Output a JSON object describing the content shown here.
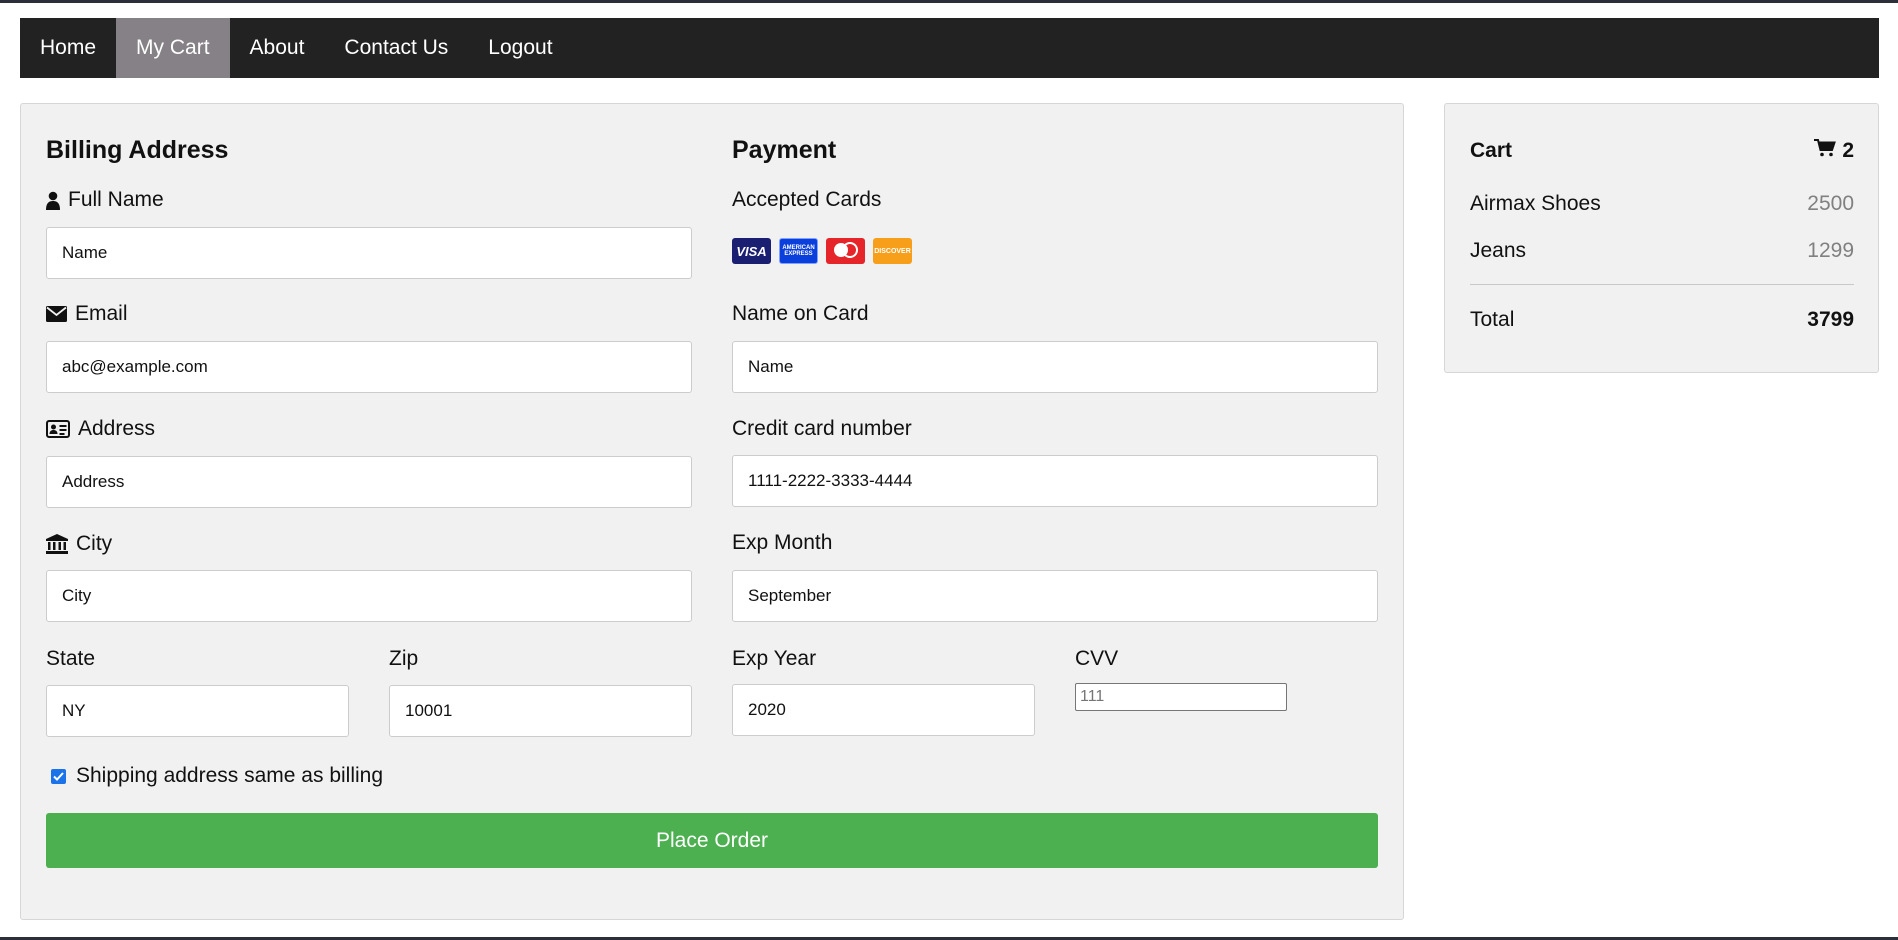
{
  "nav": {
    "items": [
      "Home",
      "My Cart",
      "About",
      "Contact Us",
      "Logout"
    ],
    "active": "My Cart"
  },
  "billing": {
    "title": "Billing Address",
    "full_name": {
      "label": "Full Name",
      "value": "Name"
    },
    "email": {
      "label": "Email",
      "value": "abc@example.com"
    },
    "address": {
      "label": "Address",
      "value": "Address"
    },
    "city": {
      "label": "City",
      "value": "City"
    },
    "state": {
      "label": "State",
      "value": "NY"
    },
    "zip": {
      "label": "Zip",
      "value": "10001"
    }
  },
  "payment": {
    "title": "Payment",
    "accepted_cards_label": "Accepted Cards",
    "cards": [
      {
        "name": "VISA",
        "color": "#1a1f71"
      },
      {
        "name": "AMERICAN EXPRESS",
        "color": "#0b3fdc"
      },
      {
        "name": "mastercard",
        "color": "#e5252a"
      },
      {
        "name": "DISCOVER",
        "color": "#f79f1a"
      }
    ],
    "name_on_card": {
      "label": "Name on Card",
      "value": "Name"
    },
    "card_number": {
      "label": "Credit card number",
      "value": "1111-2222-3333-4444"
    },
    "exp_month": {
      "label": "Exp Month",
      "value": "September"
    },
    "exp_year": {
      "label": "Exp Year",
      "value": "2020"
    },
    "cvv": {
      "label": "CVV",
      "placeholder": "111"
    }
  },
  "shipping_checkbox": {
    "label": "Shipping address same as billing",
    "checked": true
  },
  "place_order_label": "Place Order",
  "cart": {
    "title": "Cart",
    "count": "2",
    "items": [
      {
        "name": "Airmax Shoes",
        "price": "2500"
      },
      {
        "name": "Jeans",
        "price": "1299"
      }
    ],
    "total_label": "Total",
    "total_value": "3799"
  },
  "colors": {
    "navbar": "#222222",
    "nav_active": "#868087",
    "panel": "#f1f1f1",
    "button": "#4caf50"
  }
}
